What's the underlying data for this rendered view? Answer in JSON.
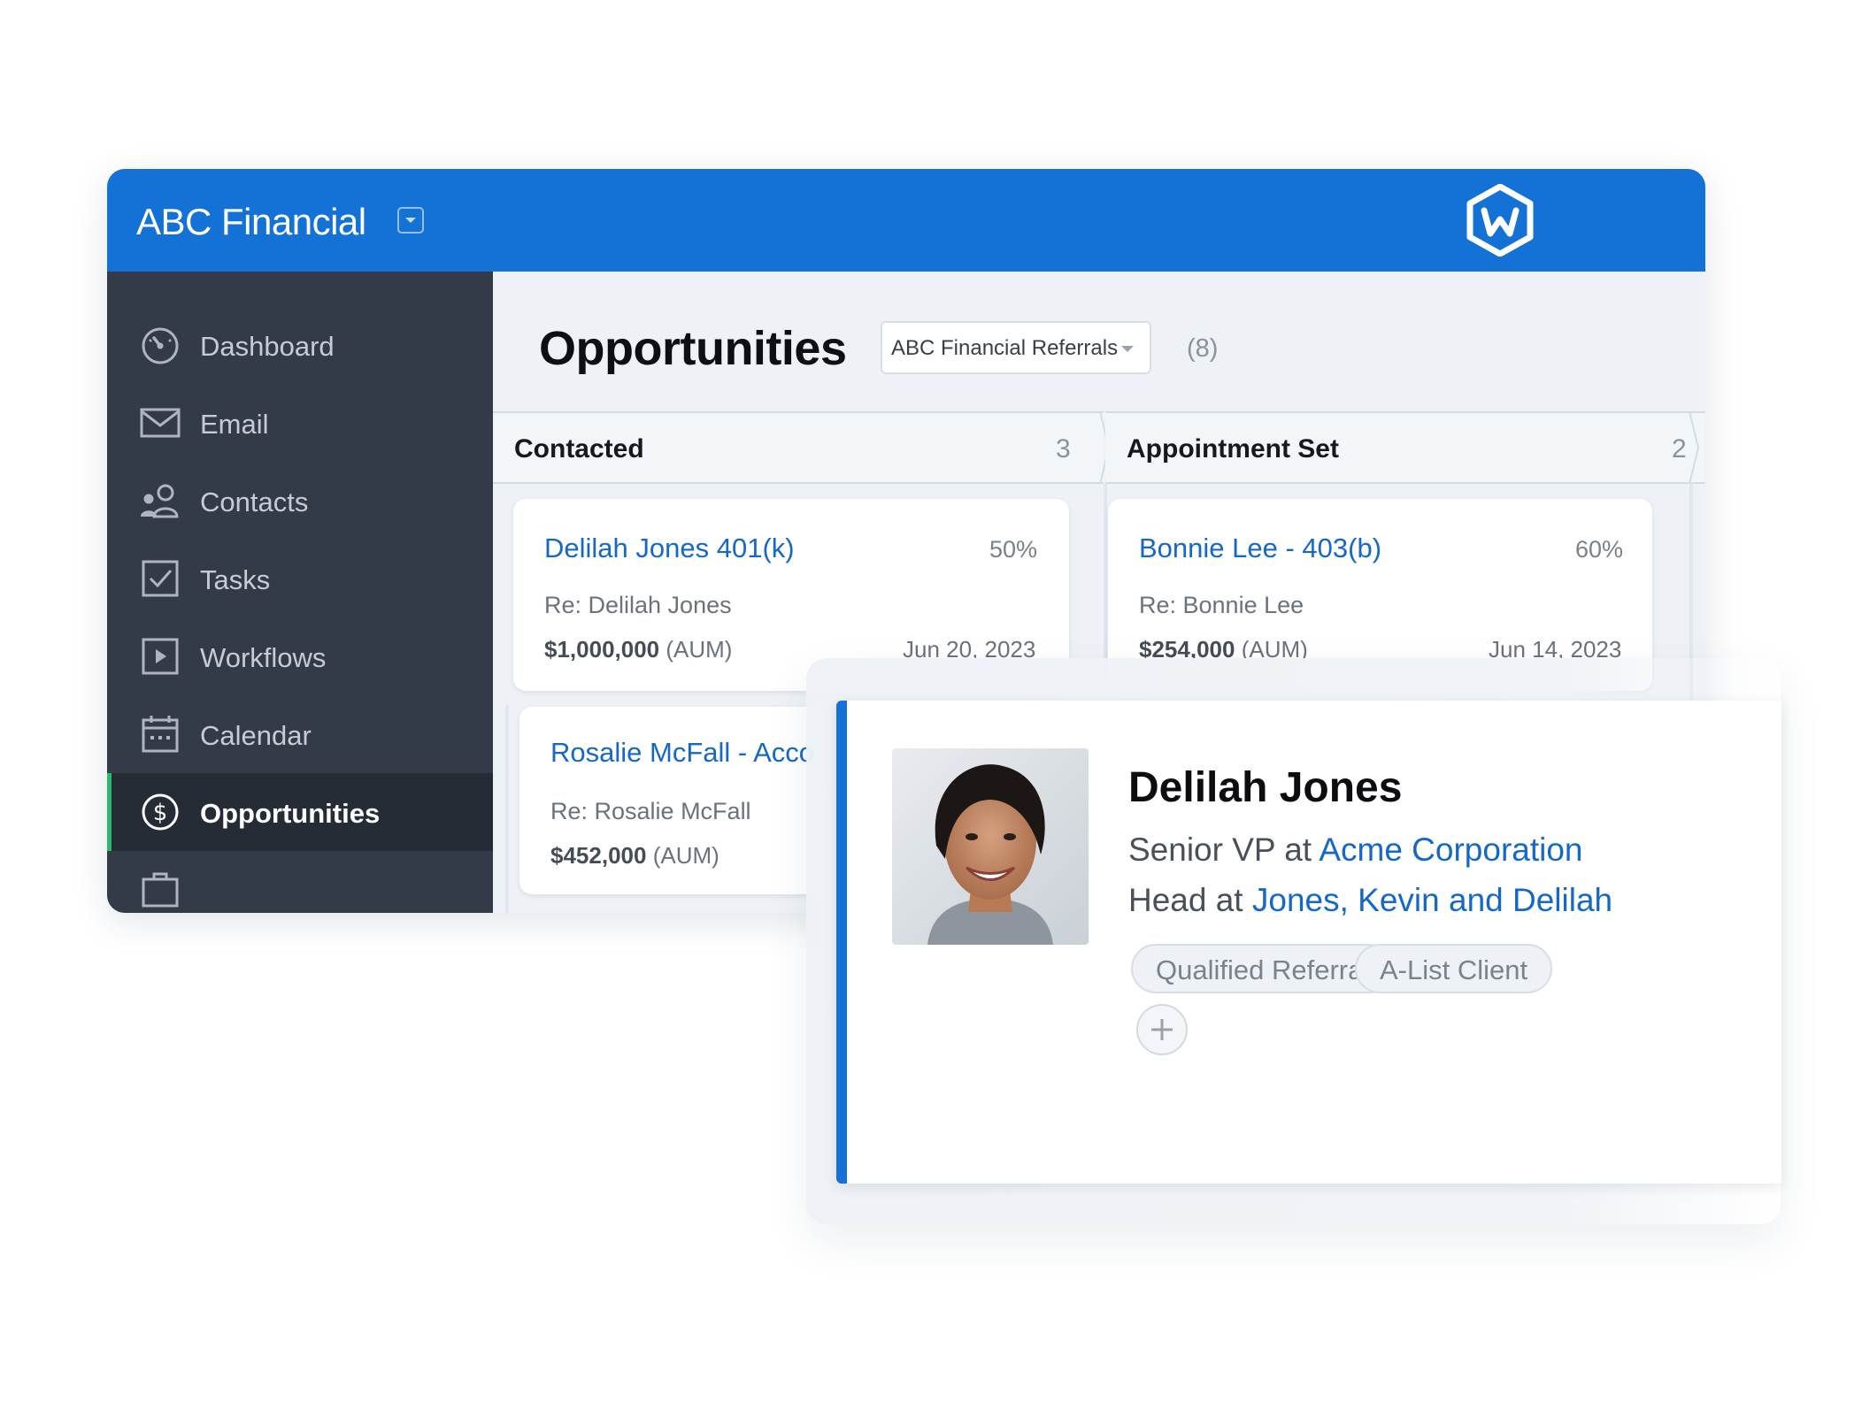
{
  "app": {
    "title": "ABC Financial",
    "brand_color": "#1471d6",
    "logo_icon": "hexagon-w-logo-icon"
  },
  "sidebar": {
    "items": [
      {
        "label": "Dashboard",
        "icon": "speedometer-icon"
      },
      {
        "label": "Email",
        "icon": "envelope-icon"
      },
      {
        "label": "Contacts",
        "icon": "people-icon"
      },
      {
        "label": "Tasks",
        "icon": "checkbox-icon"
      },
      {
        "label": "Workflows",
        "icon": "play-square-icon"
      },
      {
        "label": "Calendar",
        "icon": "calendar-icon"
      },
      {
        "label": "Opportunities",
        "icon": "dollar-circle-icon",
        "active": true
      }
    ],
    "active_color": "#2fb86b"
  },
  "main": {
    "title": "Opportunities",
    "filter": {
      "selected": "ABC Financial Referrals"
    },
    "count": "(8)",
    "columns": [
      {
        "name": "Contacted",
        "count": "3",
        "cards": [
          {
            "title": "Delilah Jones 401(k)",
            "percent": "50%",
            "re": "Re: Delilah Jones",
            "amount": "$1,000,000",
            "amount_suffix": "(AUM)",
            "date": "Jun 20, 2023"
          },
          {
            "title": "Rosalie McFall - Acco",
            "re": "Re: Rosalie McFall",
            "amount": "$452,000",
            "amount_suffix": "(AUM)"
          }
        ]
      },
      {
        "name": "Appointment Set",
        "count": "2",
        "cards": [
          {
            "title": "Bonnie Lee - 403(b)",
            "percent": "60%",
            "re": "Re: Bonnie Lee",
            "amount": "$254,000",
            "amount_suffix": "(AUM)",
            "date": "Jun 14, 2023"
          }
        ]
      }
    ]
  },
  "contact": {
    "name": "Delilah Jones",
    "avatar_icon": "person-photo-avatar",
    "roles": [
      {
        "title": "Senior VP at",
        "org": "Acme Corporation"
      },
      {
        "title": "Head at",
        "org": "Jones, Kevin and Delilah"
      }
    ],
    "tags": [
      "Qualified Referral",
      "A-List Client"
    ],
    "add_tag_icon": "plus-icon"
  }
}
